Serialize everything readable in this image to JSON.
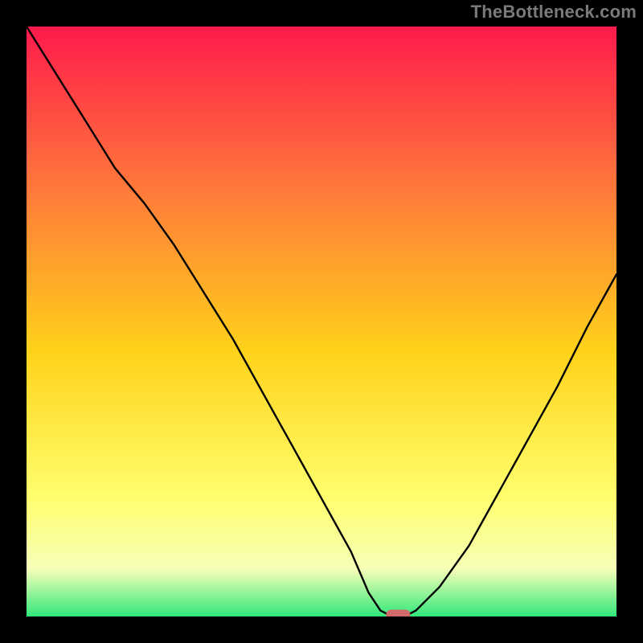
{
  "watermark": "TheBottleneck.com",
  "colors": {
    "gradient_top": "#ff1a4b",
    "gradient_mid_upper": "#ff7a3a",
    "gradient_mid": "#ffd21a",
    "gradient_mid_lower": "#ffff6e",
    "gradient_pale": "#f6ffb8",
    "gradient_green": "#32e87a",
    "curve": "#000000",
    "marker": "#d26a6a",
    "frame": "#000000"
  },
  "chart_data": {
    "type": "line",
    "title": "",
    "xlabel": "",
    "ylabel": "",
    "xlim": [
      0,
      100
    ],
    "ylim": [
      0,
      100
    ],
    "x": [
      0,
      5,
      10,
      15,
      20,
      25,
      30,
      35,
      40,
      45,
      50,
      55,
      58,
      60,
      62,
      64,
      66,
      70,
      75,
      80,
      85,
      90,
      95,
      100
    ],
    "values": [
      100,
      92,
      84,
      76,
      70,
      63,
      55,
      47,
      38,
      29,
      20,
      11,
      4,
      1,
      0,
      0,
      1,
      5,
      12,
      21,
      30,
      39,
      49,
      58
    ],
    "marker": {
      "x": 63,
      "y": 0,
      "shape": "pill"
    },
    "annotations": []
  }
}
